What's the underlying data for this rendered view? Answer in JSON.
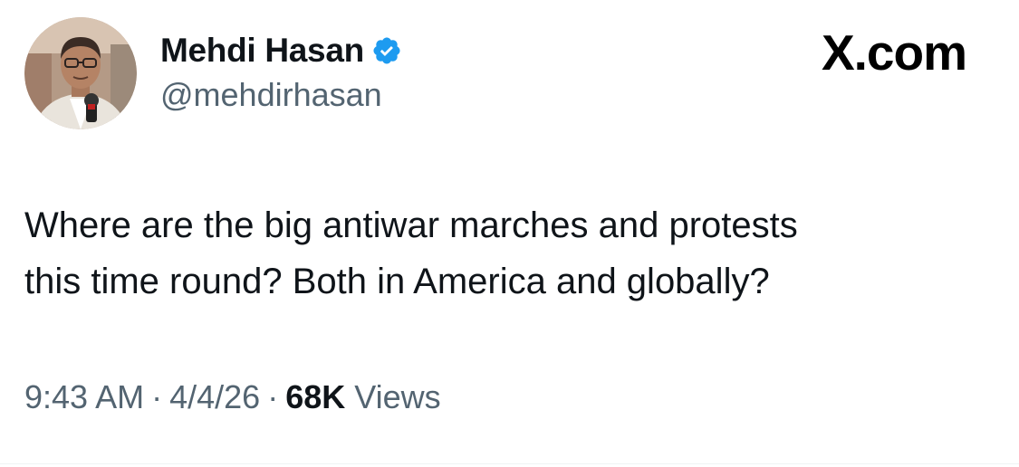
{
  "author": {
    "display_name": "Mehdi Hasan",
    "handle": "@mehdirhasan",
    "verified": true,
    "verified_color": "#1d9bf0"
  },
  "brand": {
    "label": "X.com"
  },
  "tweet": {
    "text_lines": [
      "Where are the big antiwar marches and protests",
      "this time round? Both in America and globally?"
    ]
  },
  "meta": {
    "time": "9:43 AM",
    "separator": "·",
    "date": "4/4/26",
    "views_count": "68K",
    "views_label": "Views"
  },
  "colors": {
    "text_primary": "#0f1419",
    "text_secondary": "#536471",
    "background": "#ffffff"
  }
}
